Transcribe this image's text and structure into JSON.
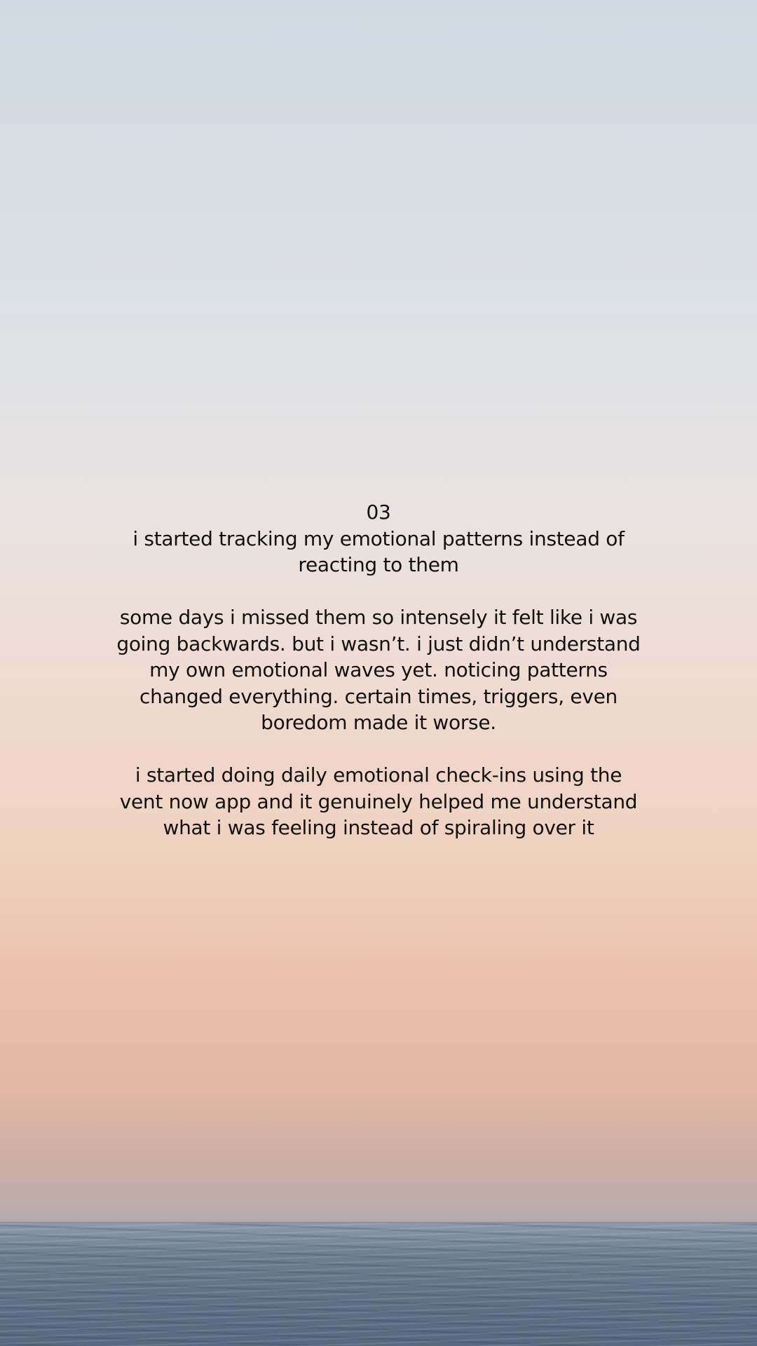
{
  "post": {
    "number": "03",
    "heading": "i started tracking my emotional patterns instead of\nreacting to them",
    "paragraph_1": "some days i missed them so intensely it felt like i was\ngoing backwards. but i wasn’t. i just didn’t understand\nmy own emotional waves yet. noticing patterns\nchanged everything. certain times, triggers, even\nboredom made it worse.",
    "paragraph_2": "i started doing daily emotional check-ins using the\nvent now app and it genuinely helped me understand\nwhat i was feeling instead of spiraling over it"
  },
  "background": {
    "description_type": "sunset sky over sea",
    "sky_top_color": "#cfd9e1",
    "sky_bottom_color": "#e3b8a3",
    "sea_color": "#5a6e84"
  }
}
